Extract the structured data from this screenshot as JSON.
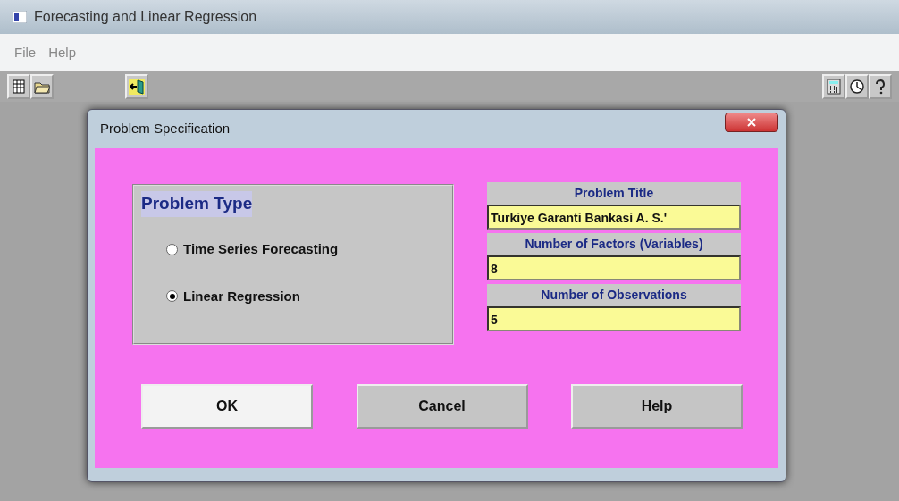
{
  "window": {
    "title": "Forecasting and Linear Regression"
  },
  "menu": [
    "File",
    "Help"
  ],
  "toolbar_left": [
    {
      "kind": "sheet"
    },
    {
      "kind": "folder"
    },
    {
      "kind": "exit"
    }
  ],
  "toolbar_right": [
    {
      "kind": "calculator"
    },
    {
      "kind": "clock"
    },
    {
      "kind": "help"
    }
  ],
  "dialog": {
    "title": "Problem Specification",
    "problem_type": {
      "label": "Problem Type",
      "options": [
        {
          "label": "Time Series Forecasting",
          "selected": false
        },
        {
          "label": "Linear Regression",
          "selected": true
        }
      ]
    },
    "fields": [
      {
        "label": "Problem Title",
        "value": "Turkiye Garanti Bankasi A. S.'"
      },
      {
        "label": "Number of Factors (Variables)",
        "value": "8"
      },
      {
        "label": "Number of Observations",
        "value": "5"
      }
    ],
    "buttons": [
      {
        "label": "OK",
        "default": true
      },
      {
        "label": "Cancel",
        "default": false
      },
      {
        "label": "Help",
        "default": false
      }
    ]
  }
}
